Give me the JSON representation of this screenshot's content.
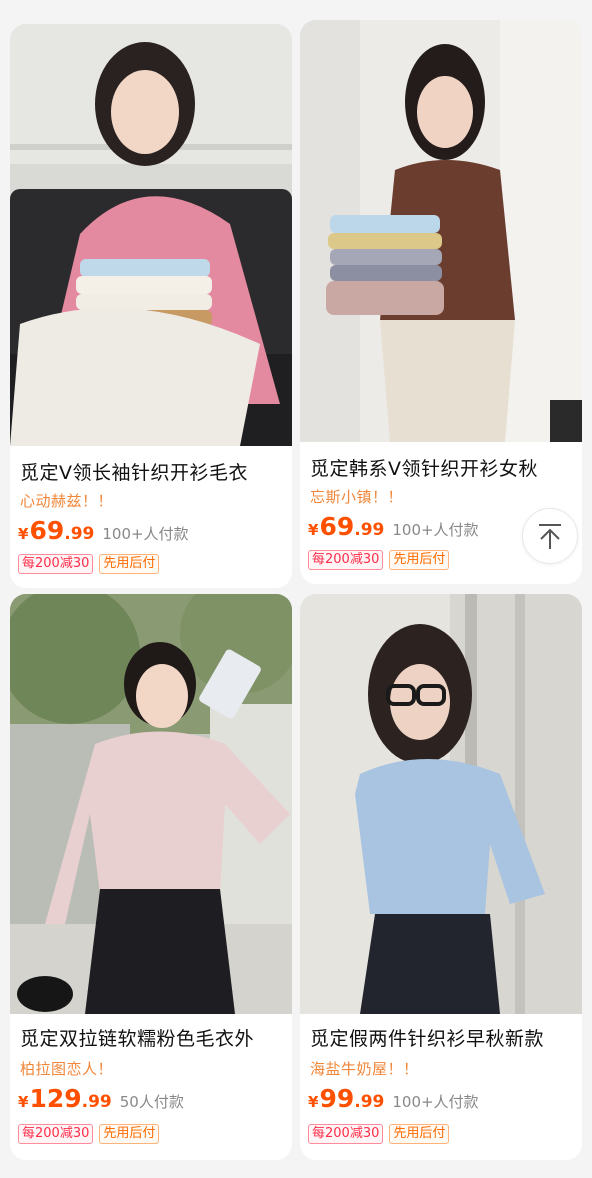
{
  "products": [
    {
      "title": "觅定V领长袖针织开衫毛衣",
      "shop": "心动赫兹！！",
      "currency": "¥",
      "price_int": "69",
      "price_dec": ".99",
      "paid": "100+人付款",
      "tags": [
        "每200减30",
        "先用后付"
      ],
      "image": "woman-pink-cardigan-with-folded-sweaters"
    },
    {
      "title": "觅定韩系V领针织开衫女秋",
      "shop": "忘斯小镇！！",
      "currency": "¥",
      "price_int": "69",
      "price_dec": ".99",
      "paid": "100+人付款",
      "tags": [
        "每200减30",
        "先用后付"
      ],
      "image": "woman-brown-cardigan-holding-sweaters"
    },
    {
      "title": "觅定双拉链软糯粉色毛衣外",
      "shop": "柏拉图恋人！",
      "currency": "¥",
      "price_int": "129",
      "price_dec": ".99",
      "paid": "50人付款",
      "tags": [
        "每200减30",
        "先用后付"
      ],
      "image": "woman-pink-fuzzy-zip-sweater"
    },
    {
      "title": "觅定假两件针织衫早秋新款",
      "shop": "海盐牛奶屋！！",
      "currency": "¥",
      "price_int": "99",
      "price_dec": ".99",
      "paid": "100+人付款",
      "tags": [
        "每200减30",
        "先用后付"
      ],
      "image": "woman-light-blue-knit-top"
    }
  ],
  "back_to_top": {
    "icon": "arrow-up-to-top-icon"
  },
  "colors": {
    "price": "#ff5000",
    "shop": "#f0873a",
    "tag_red": "#ff2d4a",
    "tag_orange": "#ff6a00"
  }
}
